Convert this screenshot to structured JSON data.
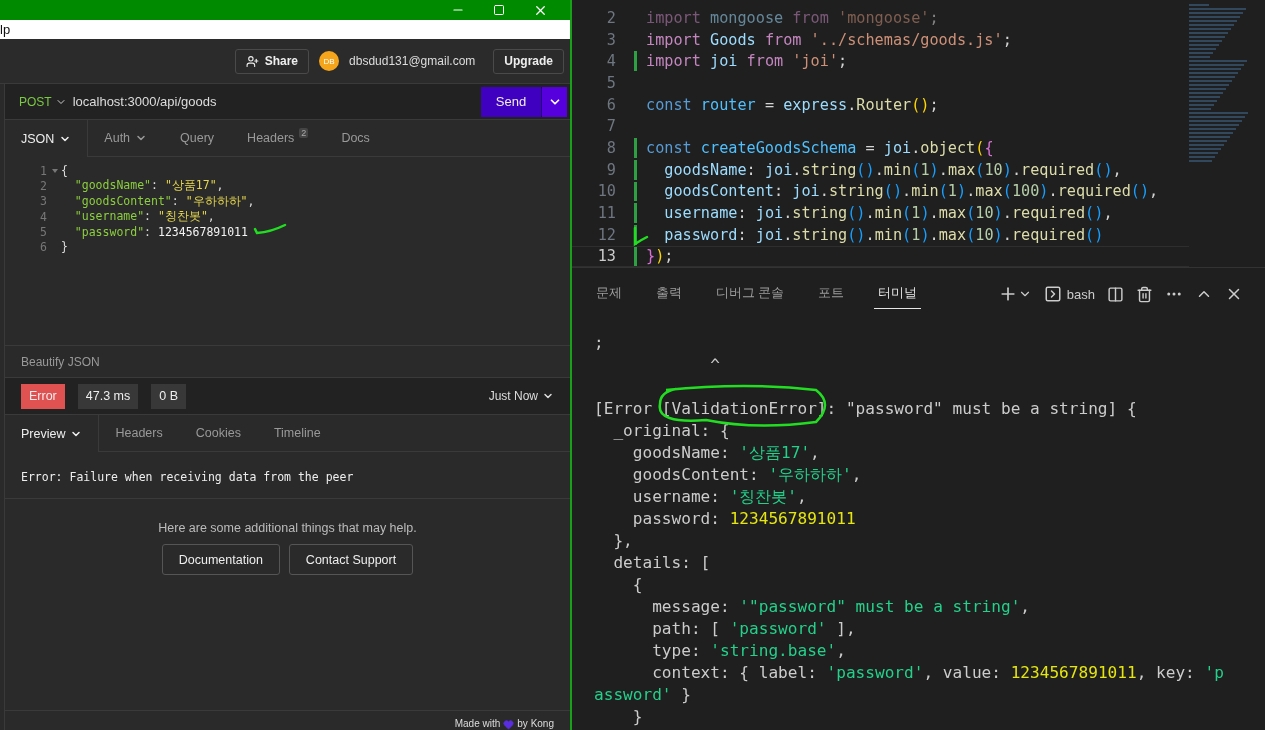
{
  "insomnia": {
    "menu_fragment": "lp",
    "header": {
      "share": "Share",
      "avatar": "DB",
      "email": "dbsdud131@gmail.com",
      "upgrade": "Upgrade"
    },
    "request": {
      "method": "POST",
      "url": "localhost:3000/api/goods",
      "send": "Send"
    },
    "request_tabs": [
      {
        "label": "JSON",
        "dropdown": true,
        "selected": true
      },
      {
        "label": "Auth",
        "dropdown": true,
        "selected": false
      },
      {
        "label": "Query",
        "dropdown": false,
        "selected": false
      },
      {
        "label": "Headers",
        "badge": "2",
        "dropdown": false,
        "selected": false
      },
      {
        "label": "Docs",
        "dropdown": false,
        "selected": false
      }
    ],
    "body_lines": [
      {
        "number": "1",
        "foldable": true,
        "tokens": [
          {
            "kind": "punct",
            "text": "{"
          }
        ]
      },
      {
        "number": "2",
        "foldable": false,
        "tokens": [
          {
            "kind": "key",
            "text": "  \"goodsName\""
          },
          {
            "kind": "punct",
            "text": ": "
          },
          {
            "kind": "string",
            "text": "\"상품17\""
          },
          {
            "kind": "punct",
            "text": ","
          }
        ]
      },
      {
        "number": "3",
        "foldable": false,
        "tokens": [
          {
            "kind": "key",
            "text": "  \"goodsContent\""
          },
          {
            "kind": "punct",
            "text": ": "
          },
          {
            "kind": "string",
            "text": "\"우하하하\""
          },
          {
            "kind": "punct",
            "text": ","
          }
        ]
      },
      {
        "number": "4",
        "foldable": false,
        "tokens": [
          {
            "kind": "key",
            "text": "  \"username\""
          },
          {
            "kind": "punct",
            "text": ": "
          },
          {
            "kind": "string",
            "text": "\"칭찬봇\""
          },
          {
            "kind": "punct",
            "text": ","
          }
        ]
      },
      {
        "number": "5",
        "foldable": false,
        "tokens": [
          {
            "kind": "key",
            "text": "  \"password\""
          },
          {
            "kind": "punct",
            "text": ": "
          },
          {
            "kind": "number",
            "text": "1234567891011"
          }
        ]
      },
      {
        "number": "6",
        "foldable": false,
        "tokens": [
          {
            "kind": "punct",
            "text": "}"
          }
        ]
      }
    ],
    "beautify": "Beautify JSON",
    "response": {
      "status": "Error",
      "time": "47.3 ms",
      "size": "0 B",
      "when": "Just Now"
    },
    "response_tabs": [
      {
        "label": "Preview",
        "dropdown": true,
        "selected": true
      },
      {
        "label": "Headers",
        "dropdown": false,
        "selected": false
      },
      {
        "label": "Cookies",
        "dropdown": false,
        "selected": false
      },
      {
        "label": "Timeline",
        "dropdown": false,
        "selected": false
      }
    ],
    "error_message": "Error: Failure when receiving data from the peer",
    "help_text": "Here are some additional things that may help.",
    "help_buttons": [
      "Documentation",
      "Contact Support"
    ],
    "footer": {
      "before": "Made with",
      "after": "by Kong"
    }
  },
  "editor": {
    "lines": [
      {
        "number": "2",
        "faded": true,
        "changed": false,
        "current": false,
        "tokens": [
          {
            "kind": "keyword",
            "text": "import"
          },
          {
            "kind": "var",
            "text": " mongoose "
          },
          {
            "kind": "keyword",
            "text": "from"
          },
          {
            "kind": "string",
            "text": " 'mongoose'"
          },
          {
            "kind": "plain",
            "text": ";"
          }
        ]
      },
      {
        "number": "3",
        "faded": false,
        "changed": false,
        "current": false,
        "tokens": [
          {
            "kind": "keyword",
            "text": "import"
          },
          {
            "kind": "var",
            "text": " Goods "
          },
          {
            "kind": "keyword",
            "text": "from"
          },
          {
            "kind": "string",
            "text": " '../schemas/goods.js'"
          },
          {
            "kind": "plain",
            "text": ";"
          }
        ]
      },
      {
        "number": "4",
        "faded": false,
        "changed": true,
        "current": false,
        "tokens": [
          {
            "kind": "keyword",
            "text": "import"
          },
          {
            "kind": "var",
            "text": " joi "
          },
          {
            "kind": "keyword",
            "text": "from"
          },
          {
            "kind": "string",
            "text": " 'joi'"
          },
          {
            "kind": "plain",
            "text": ";"
          }
        ]
      },
      {
        "number": "5",
        "changed": false,
        "current": false
      },
      {
        "number": "6",
        "faded": false,
        "changed": false,
        "current": false,
        "tokens": [
          {
            "kind": "storage",
            "text": "const"
          },
          {
            "kind": "const",
            "text": " router"
          },
          {
            "kind": "plain",
            "text": " = "
          },
          {
            "kind": "var",
            "text": "express"
          },
          {
            "kind": "plain",
            "text": "."
          },
          {
            "kind": "func",
            "text": "Router"
          },
          {
            "kind": "bracket1",
            "text": "()"
          },
          {
            "kind": "plain",
            "text": ";"
          }
        ]
      },
      {
        "number": "7",
        "changed": false,
        "current": false
      },
      {
        "number": "8",
        "faded": false,
        "changed": true,
        "current": false,
        "tokens": [
          {
            "kind": "storage",
            "text": "const"
          },
          {
            "kind": "const",
            "text": " createGoodsSchema"
          },
          {
            "kind": "plain",
            "text": " = "
          },
          {
            "kind": "var",
            "text": "joi"
          },
          {
            "kind": "plain",
            "text": "."
          },
          {
            "kind": "func",
            "text": "object"
          },
          {
            "kind": "bracket1",
            "text": "("
          },
          {
            "kind": "bracket2",
            "text": "{"
          }
        ]
      },
      {
        "number": "9",
        "faded": false,
        "changed": true,
        "current": false,
        "tokens": [
          {
            "kind": "var",
            "text": "  goodsName"
          },
          {
            "kind": "plain",
            "text": ": "
          },
          {
            "kind": "var",
            "text": "joi"
          },
          {
            "kind": "plain",
            "text": "."
          },
          {
            "kind": "func",
            "text": "string"
          },
          {
            "kind": "bracket3",
            "text": "()"
          },
          {
            "kind": "plain",
            "text": "."
          },
          {
            "kind": "func",
            "text": "min"
          },
          {
            "kind": "bracket3",
            "text": "("
          },
          {
            "kind": "number",
            "text": "1"
          },
          {
            "kind": "bracket3",
            "text": ")"
          },
          {
            "kind": "plain",
            "text": "."
          },
          {
            "kind": "func",
            "text": "max"
          },
          {
            "kind": "bracket3",
            "text": "("
          },
          {
            "kind": "number",
            "text": "10"
          },
          {
            "kind": "bracket3",
            "text": ")"
          },
          {
            "kind": "plain",
            "text": "."
          },
          {
            "kind": "func",
            "text": "required"
          },
          {
            "kind": "bracket3",
            "text": "()"
          },
          {
            "kind": "plain",
            "text": ","
          }
        ]
      },
      {
        "number": "10",
        "faded": false,
        "changed": true,
        "current": false,
        "tokens": [
          {
            "kind": "var",
            "text": "  goodsContent"
          },
          {
            "kind": "plain",
            "text": ": "
          },
          {
            "kind": "var",
            "text": "joi"
          },
          {
            "kind": "plain",
            "text": "."
          },
          {
            "kind": "func",
            "text": "string"
          },
          {
            "kind": "bracket3",
            "text": "()"
          },
          {
            "kind": "plain",
            "text": "."
          },
          {
            "kind": "func",
            "text": "min"
          },
          {
            "kind": "bracket3",
            "text": "("
          },
          {
            "kind": "number",
            "text": "1"
          },
          {
            "kind": "bracket3",
            "text": ")"
          },
          {
            "kind": "plain",
            "text": "."
          },
          {
            "kind": "func",
            "text": "max"
          },
          {
            "kind": "bracket3",
            "text": "("
          },
          {
            "kind": "number",
            "text": "100"
          },
          {
            "kind": "bracket3",
            "text": ")"
          },
          {
            "kind": "plain",
            "text": "."
          },
          {
            "kind": "func",
            "text": "required"
          },
          {
            "kind": "bracket3",
            "text": "()"
          },
          {
            "kind": "plain",
            "text": ","
          }
        ]
      },
      {
        "number": "11",
        "faded": false,
        "changed": true,
        "current": false,
        "tokens": [
          {
            "kind": "var",
            "text": "  username"
          },
          {
            "kind": "plain",
            "text": ": "
          },
          {
            "kind": "var",
            "text": "joi"
          },
          {
            "kind": "plain",
            "text": "."
          },
          {
            "kind": "func",
            "text": "string"
          },
          {
            "kind": "bracket3",
            "text": "()"
          },
          {
            "kind": "plain",
            "text": "."
          },
          {
            "kind": "func",
            "text": "min"
          },
          {
            "kind": "bracket3",
            "text": "("
          },
          {
            "kind": "number",
            "text": "1"
          },
          {
            "kind": "bracket3",
            "text": ")"
          },
          {
            "kind": "plain",
            "text": "."
          },
          {
            "kind": "func",
            "text": "max"
          },
          {
            "kind": "bracket3",
            "text": "("
          },
          {
            "kind": "number",
            "text": "10"
          },
          {
            "kind": "bracket3",
            "text": ")"
          },
          {
            "kind": "plain",
            "text": "."
          },
          {
            "kind": "func",
            "text": "required"
          },
          {
            "kind": "bracket3",
            "text": "()"
          },
          {
            "kind": "plain",
            "text": ","
          }
        ]
      },
      {
        "number": "12",
        "faded": false,
        "changed": true,
        "current": false,
        "tokens": [
          {
            "kind": "var",
            "text": "  password"
          },
          {
            "kind": "plain",
            "text": ": "
          },
          {
            "kind": "var",
            "text": "joi"
          },
          {
            "kind": "plain",
            "text": "."
          },
          {
            "kind": "func",
            "text": "string"
          },
          {
            "kind": "bracket3",
            "text": "()"
          },
          {
            "kind": "plain",
            "text": "."
          },
          {
            "kind": "func",
            "text": "min"
          },
          {
            "kind": "bracket3",
            "text": "("
          },
          {
            "kind": "number",
            "text": "1"
          },
          {
            "kind": "bracket3",
            "text": ")"
          },
          {
            "kind": "plain",
            "text": "."
          },
          {
            "kind": "func",
            "text": "max"
          },
          {
            "kind": "bracket3",
            "text": "("
          },
          {
            "kind": "number",
            "text": "10"
          },
          {
            "kind": "bracket3",
            "text": ")"
          },
          {
            "kind": "plain",
            "text": "."
          },
          {
            "kind": "func",
            "text": "required"
          },
          {
            "kind": "bracket3",
            "text": "()"
          }
        ]
      },
      {
        "number": "13",
        "faded": false,
        "changed": true,
        "current": true,
        "tokens": [
          {
            "kind": "bracket2",
            "text": "}"
          },
          {
            "kind": "bracket1",
            "text": ")"
          },
          {
            "kind": "plain",
            "text": ";"
          }
        ]
      }
    ]
  },
  "panel": {
    "tabs": [
      {
        "label": "문제",
        "selected": false
      },
      {
        "label": "출력",
        "selected": false
      },
      {
        "label": "디버그 콘솔",
        "selected": false
      },
      {
        "label": "포트",
        "selected": false
      },
      {
        "label": "터미널",
        "selected": true
      }
    ],
    "shell": "bash"
  },
  "terminal": {
    "lines": [
      {
        "tokens": [
          {
            "kind": "plain",
            "text": ";"
          }
        ]
      },
      {
        "tokens": [
          {
            "kind": "plain",
            "text": "            ^"
          }
        ]
      },
      {
        "gap_before": true,
        "tokens": [
          {
            "kind": "plain",
            "text": "[Error [ValidationError]: \"password\" must be a string] {"
          }
        ]
      },
      {
        "tokens": [
          {
            "kind": "plain",
            "text": "  _original: {"
          }
        ]
      },
      {
        "tokens": [
          {
            "kind": "plain",
            "text": "    goodsName: "
          },
          {
            "kind": "string",
            "text": "'상품17'"
          },
          {
            "kind": "plain",
            "text": ","
          }
        ]
      },
      {
        "tokens": [
          {
            "kind": "plain",
            "text": "    goodsContent: "
          },
          {
            "kind": "string",
            "text": "'우하하하'"
          },
          {
            "kind": "plain",
            "text": ","
          }
        ]
      },
      {
        "tokens": [
          {
            "kind": "plain",
            "text": "    username: "
          },
          {
            "kind": "string",
            "text": "'칭찬봇'"
          },
          {
            "kind": "plain",
            "text": ","
          }
        ]
      },
      {
        "tokens": [
          {
            "kind": "plain",
            "text": "    password: "
          },
          {
            "kind": "number",
            "text": "1234567891011"
          }
        ]
      },
      {
        "tokens": [
          {
            "kind": "plain",
            "text": "  },"
          }
        ]
      },
      {
        "tokens": [
          {
            "kind": "plain",
            "text": "  details: ["
          }
        ]
      },
      {
        "tokens": [
          {
            "kind": "plain",
            "text": "    {"
          }
        ]
      },
      {
        "tokens": [
          {
            "kind": "plain",
            "text": "      message: "
          },
          {
            "kind": "string",
            "text": "'\"password\" must be a string'"
          },
          {
            "kind": "plain",
            "text": ","
          }
        ]
      },
      {
        "tokens": [
          {
            "kind": "plain",
            "text": "      path: [ "
          },
          {
            "kind": "string",
            "text": "'password'"
          },
          {
            "kind": "plain",
            "text": " ],"
          }
        ]
      },
      {
        "tokens": [
          {
            "kind": "plain",
            "text": "      type: "
          },
          {
            "kind": "string",
            "text": "'string.base'"
          },
          {
            "kind": "plain",
            "text": ","
          }
        ]
      },
      {
        "tokens": [
          {
            "kind": "plain",
            "text": "      context: { label: "
          },
          {
            "kind": "string",
            "text": "'password'"
          },
          {
            "kind": "plain",
            "text": ", value: "
          },
          {
            "kind": "number",
            "text": "1234567891011"
          },
          {
            "kind": "plain",
            "text": ", key: "
          },
          {
            "kind": "string",
            "text": "'p"
          }
        ]
      },
      {
        "tokens": [
          {
            "kind": "string",
            "text": "assword'"
          },
          {
            "kind": "plain",
            "text": " }"
          }
        ]
      },
      {
        "tokens": [
          {
            "kind": "plain",
            "text": "    }"
          }
        ]
      }
    ]
  }
}
